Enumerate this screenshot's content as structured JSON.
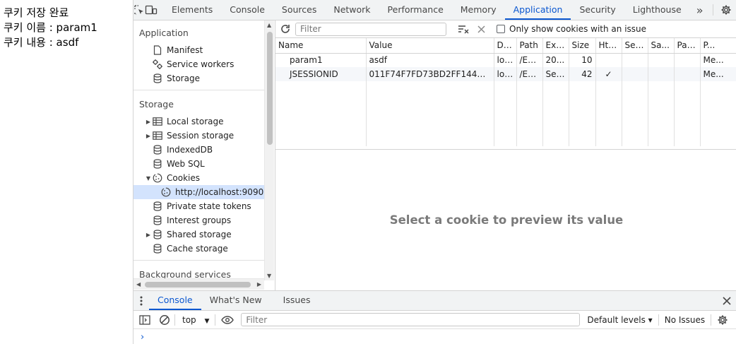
{
  "page": {
    "lines": [
      "쿠키 저장 완료",
      "쿠키 이름 : param1",
      "쿠키 내용 : asdf"
    ]
  },
  "devtools": {
    "tabs": [
      "Elements",
      "Console",
      "Sources",
      "Network",
      "Performance",
      "Memory",
      "Application",
      "Security",
      "Lighthouse"
    ],
    "active_tab": "Application",
    "more_tabs": "»"
  },
  "sidebar": {
    "application_title": "Application",
    "application_items": [
      "Manifest",
      "Service workers",
      "Storage"
    ],
    "storage_title": "Storage",
    "storage_items": [
      "Local storage",
      "Session storage",
      "IndexedDB",
      "Web SQL",
      "Cookies"
    ],
    "cookie_origin": "http://localhost:9090",
    "storage_items_after": [
      "Private state tokens",
      "Interest groups",
      "Shared storage",
      "Cache storage"
    ],
    "background_title": "Background services"
  },
  "cookies": {
    "filter_placeholder": "Filter",
    "only_issues_label": "Only show cookies with an issue",
    "columns": [
      "Name",
      "Value",
      "Do...",
      "Path",
      "Exp...",
      "Size",
      "Htt...",
      "Sec...",
      "Sa...",
      "Par...",
      "P..."
    ],
    "rows": [
      [
        "param1",
        "asdf",
        "loc...",
        "/Ex...",
        "20...",
        "10",
        "",
        "",
        "",
        "",
        "Me..."
      ],
      [
        "JSESSIONID",
        "011F74F7FD73BD2FF1449FE7...",
        "loc...",
        "/Ex...",
        "Ses...",
        "42",
        "✓",
        "",
        "",
        "",
        "Me..."
      ]
    ],
    "preview_text": "Select a cookie to preview its value"
  },
  "drawer": {
    "tabs": [
      "Console",
      "What's New",
      "Issues"
    ],
    "active_tab": "Console",
    "context": "top",
    "filter_placeholder": "Filter",
    "levels": "Default levels ▾",
    "issues": "No Issues",
    "prompt": "›"
  },
  "colors": {
    "accent": "#0b57d0",
    "selected_bg": "#d3e3fd",
    "toolbar_bg": "#f1f3f4"
  }
}
